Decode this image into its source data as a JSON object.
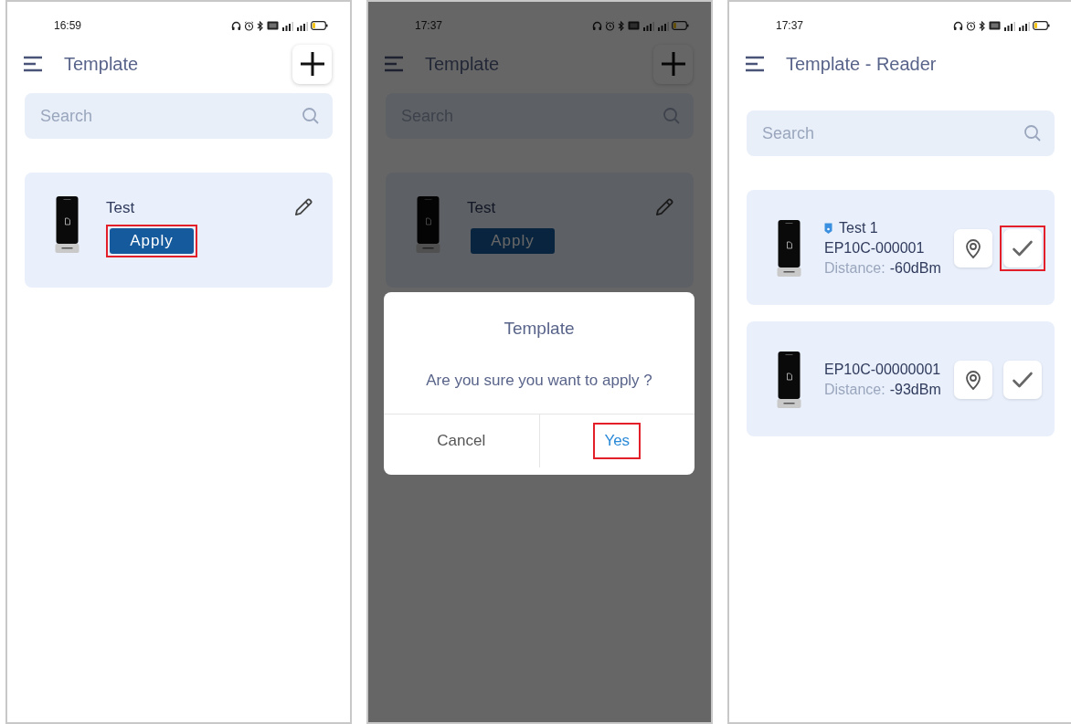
{
  "screens": [
    {
      "status_bar": {
        "time": "16:59"
      },
      "header": {
        "title": "Template",
        "add_button": true
      },
      "search": {
        "placeholder": "Search"
      },
      "dimmed": false,
      "cards": [
        {
          "kind": "template",
          "name": "Test",
          "action": "Apply",
          "highlighted": true
        }
      ]
    },
    {
      "status_bar": {
        "time": "17:37"
      },
      "header": {
        "title": "Template",
        "add_button": true
      },
      "search": {
        "placeholder": "Search"
      },
      "dimmed": true,
      "cards": [
        {
          "kind": "template",
          "name": "Test",
          "action": "Apply",
          "highlighted": false
        }
      ],
      "dialog": {
        "title": "Template",
        "message": "Are you sure you want to apply ?",
        "buttons": [
          {
            "label": "Cancel",
            "kind": "cancel",
            "highlighted": false
          },
          {
            "label": "Yes",
            "kind": "confirm",
            "highlighted": true
          }
        ]
      }
    },
    {
      "status_bar": {
        "time": "17:37"
      },
      "header": {
        "title": "Template - Reader",
        "add_button": false
      },
      "search": {
        "placeholder": "Search"
      },
      "dimmed": false,
      "cards": [
        {
          "kind": "reader",
          "tag": "Test 1",
          "serial": "EP10C-000001",
          "distance_label": "Distance:",
          "distance": "-60dBm",
          "highlighted": true
        },
        {
          "kind": "reader",
          "serial": "EP10C-00000001",
          "distance_label": "Distance:",
          "distance": "-93dBm",
          "highlighted": false
        }
      ]
    }
  ]
}
